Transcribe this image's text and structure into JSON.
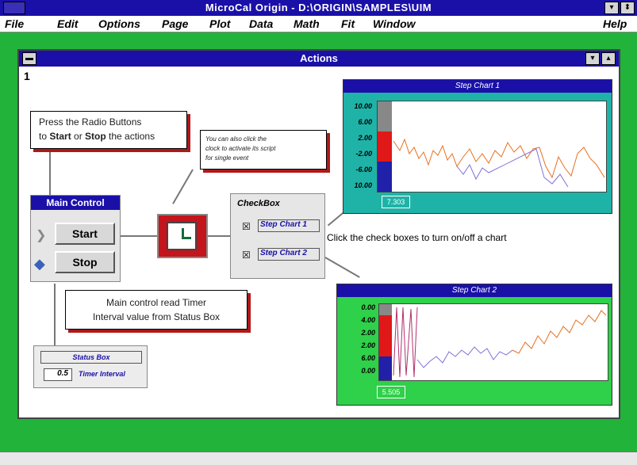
{
  "app": {
    "title": "MicroCal Origin - D:\\ORIGIN\\SAMPLES\\UIM"
  },
  "menu": {
    "items": [
      "File",
      "Edit",
      "Options",
      "Page",
      "Plot",
      "Data",
      "Math",
      "Fit",
      "Window"
    ],
    "help": "Help"
  },
  "window": {
    "title": "Actions",
    "page_number": "1"
  },
  "notes": {
    "radio_line1": "Press the Radio Buttons",
    "radio_line2_pre": "to ",
    "radio_start": "Start",
    "radio_or": " or ",
    "radio_stop": "Stop",
    "radio_line2_post": " the actions",
    "clock_line1": "You can also click the",
    "clock_line2": "clock to activate its script",
    "clock_line3": "for single event",
    "timer_line1": "Main control read Timer",
    "timer_line2": "Interval value from Status Box",
    "checkbox_hint": "Click the check boxes to turn on/off a chart"
  },
  "main_control": {
    "title": "Main Control",
    "start": "Start",
    "stop": "Stop"
  },
  "checkbox": {
    "title": "CheckBox",
    "items": [
      "Step Chart 1",
      "Step Chart 2"
    ]
  },
  "status_box": {
    "title": "Status Box",
    "value": "0.5",
    "label": "Timer Interval"
  },
  "chart1": {
    "title": "Step Chart 1",
    "ticks": [
      "10.00",
      "6.00",
      "2.00",
      "-2.00",
      "-6.00",
      "10.00"
    ],
    "readout": "7.303"
  },
  "chart2": {
    "title": "Step Chart 2",
    "ticks": [
      "0.00",
      "4.00",
      "2.00",
      "2.00",
      "6.00",
      "0.00"
    ],
    "readout": "5.505"
  },
  "colors": {
    "titlebar": "#1a10a8",
    "workspace": "#22b33a",
    "chart1_bg": "#1fb3a8",
    "chart2_bg": "#2fd04a",
    "accent_red": "#b01818"
  }
}
